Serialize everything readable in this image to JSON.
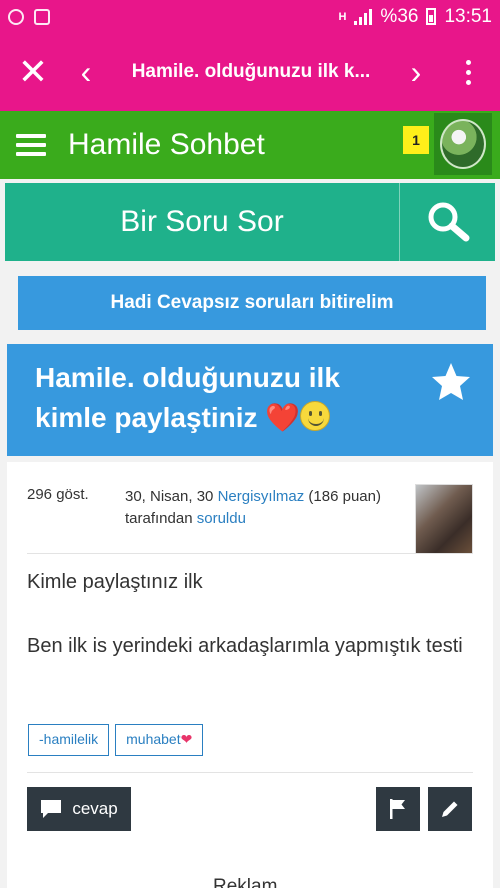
{
  "status_bar": {
    "battery": "%36",
    "time": "13:51",
    "network": "H"
  },
  "browser": {
    "title": "Hamile. olduğunuzu ilk k...",
    "close_icon": "close-icon",
    "back_icon": "chevron-left-icon",
    "forward_icon": "chevron-right-icon",
    "menu_icon": "more-vert-icon"
  },
  "site": {
    "title": "Hamile Sohbet",
    "notification_count": "1"
  },
  "ask": {
    "label": "Bir Soru Sor"
  },
  "unanswered": {
    "label": "Hadi Cevapsız soruları bitirelim"
  },
  "question": {
    "title": "Hamile. olduğunuzu ilk kimle paylaştiniz",
    "heart": "❤️",
    "views": "296 göst.",
    "date_prefix": "30, Nisan, 30",
    "author": "Nergisyılmaz",
    "points": "(186 puan)",
    "by_text": "tarafından",
    "asked_link": "soruldu",
    "body_1": "Kimle paylaştınız ilk",
    "body_2": "Ben ilk is yerindeki arkadaşlarımla yapmıştık testi",
    "tags": [
      "-hamilelik",
      "muhabet"
    ],
    "tag_heart": "❤",
    "answer_label": "cevap"
  },
  "footer": {
    "partial_text": "Reklam"
  },
  "colors": {
    "pink": "#e8168a",
    "green": "#3aab1c",
    "teal": "#1fb18b",
    "blue": "#3799de",
    "dark": "#2f3941"
  }
}
